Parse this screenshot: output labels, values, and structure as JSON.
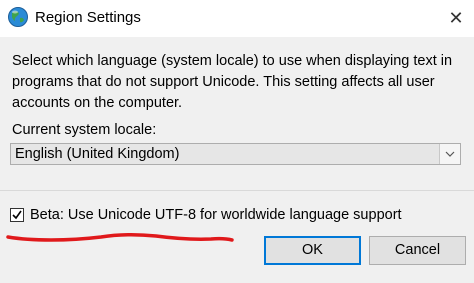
{
  "window": {
    "title": "Region Settings",
    "close_glyph": "✕",
    "icon": "globe-icon"
  },
  "main": {
    "description": "Select which language (system locale) to use when displaying text in programs that do not support Unicode. This setting affects all user accounts on the computer.",
    "locale_label_prefix": "Current system locale:",
    "locale_select": {
      "value": "English (United Kingdom)",
      "icon": "chevron-down-icon"
    },
    "beta_checkbox": {
      "checked": true,
      "label": "Beta: Use Unicode UTF-8 for worldwide language support"
    },
    "annotation": {
      "color": "#e0191b"
    }
  },
  "buttons": {
    "ok_label": "OK",
    "cancel_label": "Cancel",
    "accent": "#0078d7"
  }
}
